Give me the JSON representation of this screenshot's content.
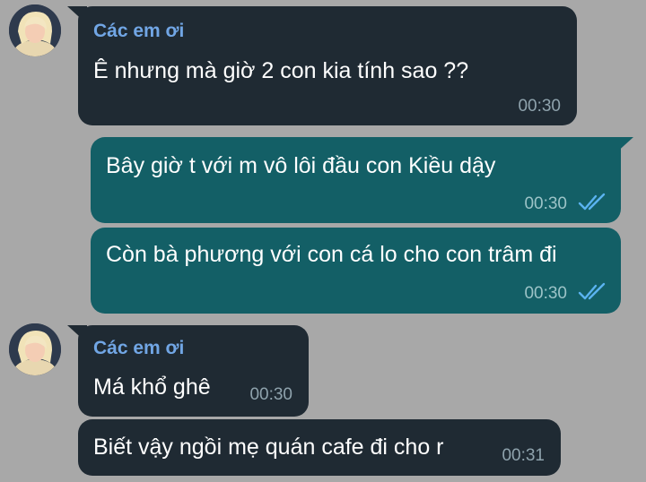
{
  "chat": {
    "group_sender": "Các em ơi",
    "messages": [
      {
        "text": "Ê nhưng mà giờ 2 con kia tính sao ??",
        "time": "00:30"
      },
      {
        "text": "Bây giờ t với m vô lôi đầu con Kiều dậy",
        "time": "00:30"
      },
      {
        "text": "Còn bà phương với con cá lo cho con trâm đi",
        "time": "00:30"
      },
      {
        "text": "Má khổ ghê",
        "time": "00:30"
      },
      {
        "text": "Biết vậy ngồi mẹ quán cafe đi cho r",
        "time": "00:31"
      }
    ]
  },
  "icons": {
    "read_receipt": "double-check-icon",
    "avatar": "profile-photo"
  },
  "colors": {
    "background": "#a8a8a8",
    "incoming_bubble": "#1f2a33",
    "outgoing_bubble": "#135f66",
    "sender_name": "#71a6e5",
    "read_check": "#5ab3f0"
  }
}
